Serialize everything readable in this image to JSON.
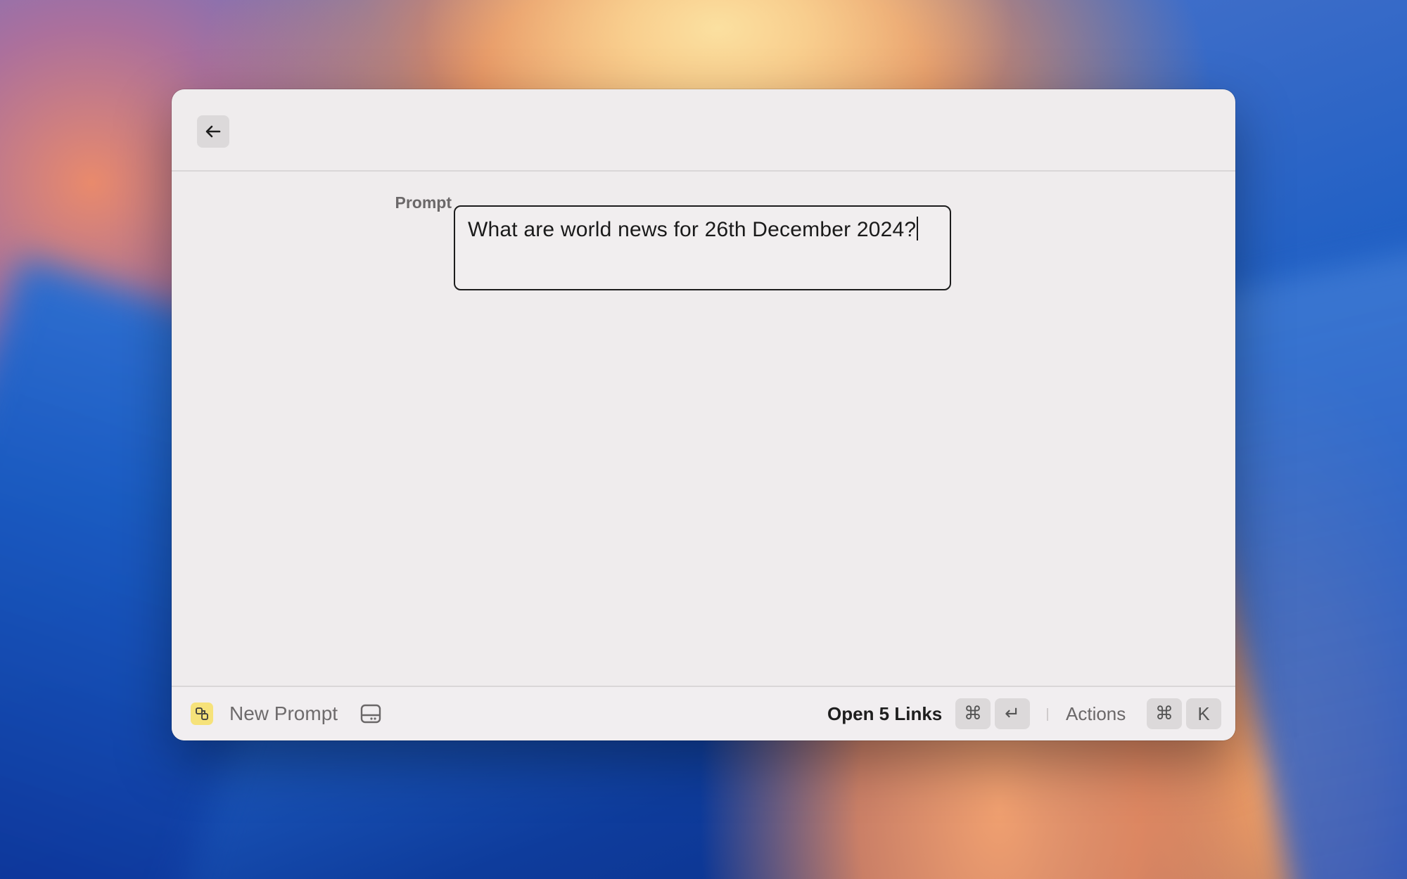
{
  "topbar": {
    "back_icon": "arrow-left-icon"
  },
  "form": {
    "prompt_label": "Prompt",
    "prompt_value": "What are world news for 26th December 2024?"
  },
  "footer": {
    "extension_icon": "extension-icon",
    "extension_title": "New Prompt",
    "storage_icon": "hard-drive-icon",
    "primary_action": "Open 5 Links",
    "primary_shortcut": [
      "⌘",
      "↵"
    ],
    "actions_label": "Actions",
    "actions_shortcut": [
      "⌘",
      "K"
    ]
  },
  "colors": {
    "window_bg": "#efeced",
    "extension_icon_bg": "#f6e27a",
    "key_bg": "#dcd9da"
  }
}
